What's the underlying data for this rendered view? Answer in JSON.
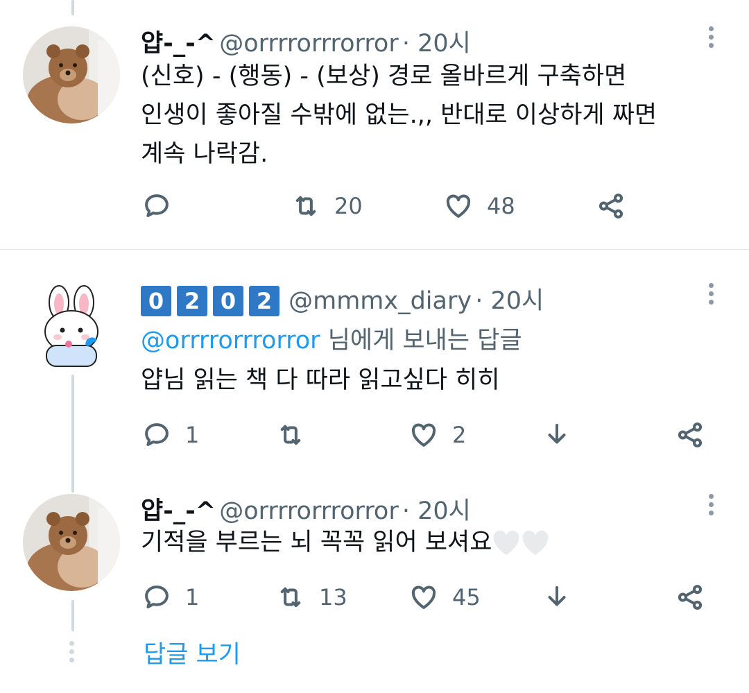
{
  "tweet1": {
    "display_name": "얍-_-^",
    "handle": "@orrrrorrrorror",
    "time": "· 20시",
    "lines": [
      "(신호) - (행동) - (보상) 경로 올바르게 구축하면",
      "인생이 좋아질 수밖에 없는.,, 반대로 이상하게 짜면",
      "계속 나락감."
    ],
    "retweets": "20",
    "likes": "48",
    "avatar_icon": "teddy-bear-avatar"
  },
  "tweet2": {
    "badge_chars": [
      "0",
      "2",
      "0",
      "2"
    ],
    "handle": "@mmmx_diary",
    "time": "· 20시",
    "reply_to_handle": "@orrrrorrrorror",
    "reply_to_suffix": " 님에게 보내는 답글",
    "text": "얍님 읽는 책 다 따라 읽고싶다 히히",
    "replies": "1",
    "likes": "2",
    "avatar_icon": "bunny-avatar"
  },
  "tweet3": {
    "display_name": "얍-_-^",
    "handle": "@orrrrorrrorror",
    "time": "· 20시",
    "text": "기적을 부르는 뇌 꼭꼭 읽어 보셔요",
    "emoji": [
      "white-heart-icon",
      "white-heart-icon"
    ],
    "replies": "1",
    "retweets": "13",
    "likes": "45",
    "avatar_icon": "teddy-bear-avatar"
  },
  "show_replies_label": "답글 보기",
  "colors": {
    "link": "#1d9bf0",
    "muted": "#536471",
    "badge": "#2f78c6",
    "thread_line": "#cfd9de"
  }
}
